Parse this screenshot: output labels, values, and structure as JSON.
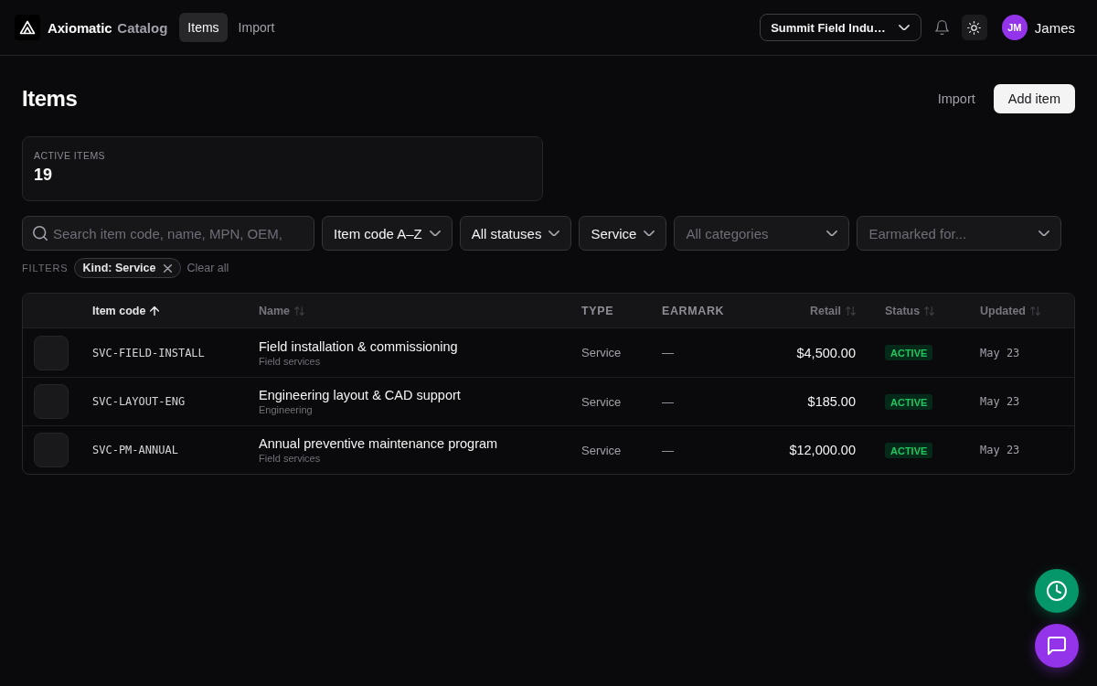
{
  "header": {
    "brand": "Axiomatic",
    "product": "Catalog",
    "nav": [
      {
        "label": "Items",
        "selected": true
      },
      {
        "label": "Import",
        "selected": false
      }
    ],
    "org_select": {
      "value": "Summit Field Indu…"
    },
    "user": {
      "initials": "JM",
      "name": "James"
    }
  },
  "page": {
    "title": "Items",
    "actions": [
      {
        "label": "Import",
        "kind": "ghost"
      },
      {
        "label": "Add item",
        "kind": "primary"
      }
    ]
  },
  "stats": [
    {
      "label": "ACTIVE ITEMS",
      "value": "19"
    }
  ],
  "toolbar": {
    "search": {
      "placeholder": "Search item code, name, MPN, OEM,"
    },
    "dropdowns": [
      {
        "value": "Item code A–Z"
      },
      {
        "value": "All statuses"
      },
      {
        "value": "Service"
      },
      {
        "placeholder": "All categories"
      },
      {
        "placeholder": "Earmarked for..."
      }
    ]
  },
  "filters": {
    "label": "FILTERS",
    "chips": [
      {
        "label": "Kind: Service"
      }
    ],
    "clear": "Clear all"
  },
  "table": {
    "columns": [
      {
        "label": "Item code",
        "sortable": true,
        "sorted": true
      },
      {
        "label": "Name",
        "sortable": true,
        "sorted": false
      },
      {
        "label": "TYPE",
        "sortable": false,
        "sorted": false
      },
      {
        "label": "EARMARK",
        "sortable": false,
        "sorted": false
      },
      {
        "label": "Retail",
        "sortable": true,
        "sorted": false
      },
      {
        "label": "Status",
        "sortable": true,
        "sorted": false
      },
      {
        "label": "Updated",
        "sortable": true,
        "sorted": false
      }
    ],
    "rows": [
      {
        "code": "SVC-FIELD-INSTALL",
        "name": "Field installation & commissioning",
        "category": "Field services",
        "type": "Service",
        "earmark": "—",
        "retail": "$4,500.00",
        "status": "ACTIVE",
        "updated": "May 23"
      },
      {
        "code": "SVC-LAYOUT-ENG",
        "name": "Engineering layout & CAD support",
        "category": "Engineering",
        "type": "Service",
        "earmark": "—",
        "retail": "$185.00",
        "status": "ACTIVE",
        "updated": "May 23"
      },
      {
        "code": "SVC-PM-ANNUAL",
        "name": "Annual preventive maintenance program",
        "category": "Field services",
        "type": "Service",
        "earmark": "—",
        "retail": "$12,000.00",
        "status": "ACTIVE",
        "updated": "May 23"
      }
    ]
  }
}
